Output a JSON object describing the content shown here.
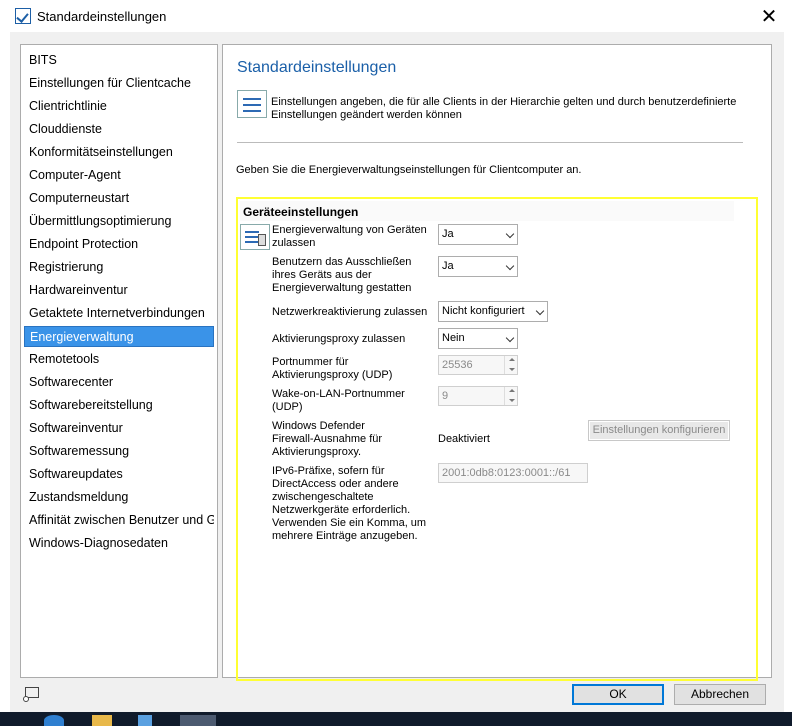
{
  "window": {
    "title": "Standardeinstellungen",
    "close_glyph": "✕"
  },
  "nav": {
    "items": [
      {
        "label": "BITS"
      },
      {
        "label": "Einstellungen für Clientcache"
      },
      {
        "label": "Clientrichtlinie"
      },
      {
        "label": "Clouddienste"
      },
      {
        "label": "Konformitätseinstellungen"
      },
      {
        "label": "Computer-Agent"
      },
      {
        "label": "Computerneustart"
      },
      {
        "label": "Übermittlungsoptimierung"
      },
      {
        "label": "Endpoint Protection"
      },
      {
        "label": "Registrierung"
      },
      {
        "label": "Hardwareinventur"
      },
      {
        "label": "Getaktete Internetverbindungen"
      },
      {
        "label": "Energieverwaltung",
        "selected": true
      },
      {
        "label": "Remotetools"
      },
      {
        "label": "Softwarecenter"
      },
      {
        "label": "Softwarebereitstellung"
      },
      {
        "label": "Softwareinventur"
      },
      {
        "label": "Softwaremessung"
      },
      {
        "label": "Softwareupdates"
      },
      {
        "label": "Zustandsmeldung"
      },
      {
        "label": "Affinität zwischen Benutzer und Ge"
      },
      {
        "label": "Windows-Diagnosedaten"
      }
    ]
  },
  "content": {
    "title": "Standardeinstellungen",
    "info": "Einstellungen angeben, die für alle Clients in der Hierarchie gelten und durch benutzerdefinierte Einstellungen geändert werden können",
    "intro": "Geben Sie die Energieverwaltungseinstellungen für Clientcomputer an.",
    "group_title": "Geräteeinstellungen",
    "settings": {
      "allow_power_mgmt_label": "Energieverwaltung von Geräten zulassen",
      "allow_power_mgmt_value": "Ja",
      "allow_users_exclude_label": "Benutzern das Ausschließen ihres Geräts aus der Energieverwaltung gestatten",
      "allow_users_exclude_value": "Ja",
      "network_wake_label": "Netzwerkreaktivierung zulassen",
      "network_wake_value": "Nicht konfiguriert",
      "wake_proxy_label": "Aktivierungsproxy zulassen",
      "wake_proxy_value": "Nein",
      "port_label": "Portnummer für Aktivierungsproxy (UDP)",
      "port_value": "25536",
      "wol_port_label": "Wake-on-LAN-Portnummer (UDP)",
      "wol_port_value": "9",
      "firewall_label": "Windows Defender Firewall-Ausnahme für Aktivierungsproxy.",
      "firewall_value": "Deaktiviert",
      "configure_button": "Einstellungen konfigurieren",
      "ipv6_label": "IPv6-Präfixe, sofern für DirectAccess oder andere zwischengeschaltete Netzwerkgeräte erforderlich. Verwenden Sie ein Komma, um mehrere Einträge anzugeben.",
      "ipv6_value": "2001:0db8:0123:0001::/61"
    }
  },
  "footer": {
    "ok": "OK",
    "cancel": "Abbrechen"
  },
  "colors": {
    "accent": "#1a5fa8",
    "selected_nav": "#3a93e8",
    "highlight_box": "#ffff33"
  }
}
